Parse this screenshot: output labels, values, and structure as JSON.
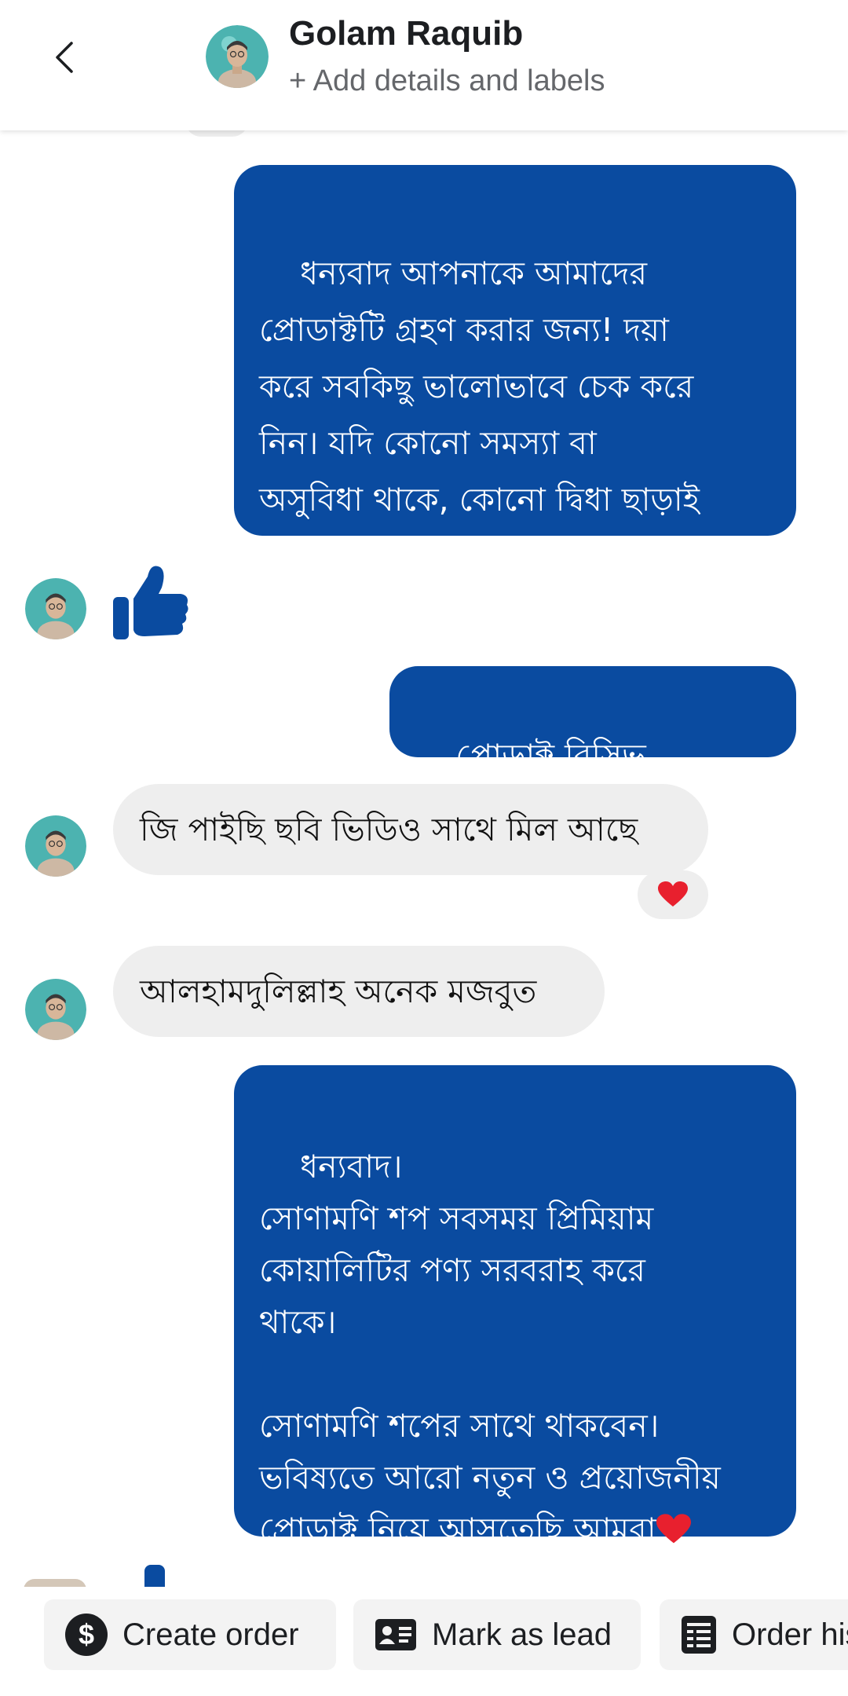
{
  "header": {
    "contact_name": "Golam Raquib",
    "add_details": "+ Add details and labels"
  },
  "messages": [
    {
      "direction": "out",
      "text": "ধন্যবাদ আপনাকে আমাদের\nপ্রোডাক্টটি গ্রহণ করার জন্য! দয়া\nকরে সবকিছু ভালোভাবে চেক করে\nনিন। যদি কোনো সমস্যা বা\nঅসুবিধা থাকে, কোনো দ্বিধা ছাড়াই\nআমাদের জানাবেন।"
    },
    {
      "direction": "in",
      "type": "like-sticker",
      "icon": "thumbs-up-icon"
    },
    {
      "direction": "out",
      "text": "প্রোডাক্ট রিসিভ করেছেন?"
    },
    {
      "direction": "in",
      "text": "জি পাইছি ছবি ভিডিও সাথে মিল আছে",
      "reaction": "heart-icon"
    },
    {
      "direction": "in",
      "text": "আলহামদুলিল্লাহ অনেক মজবুত"
    },
    {
      "direction": "out",
      "text": "ধন্যবাদ।\nসোণামণি শপ সবসময় প্রিমিয়াম\nকোয়ালিটির পণ্য সরবরাহ করে\nথাকে।\n\nসোণামণি শপের সাথে থাকবেন।\nভবিষ্যতে আরো নতুন ও প্রয়োজনীয়\nপ্রোডাক্ট নিয়ে আসতেছি আমরা",
      "trailing_icon": "heart-icon"
    }
  ],
  "actions": [
    {
      "label": "Create order",
      "icon": "dollar-icon"
    },
    {
      "label": "Mark as lead",
      "icon": "contact-card-icon"
    },
    {
      "label": "Order history",
      "icon": "receipt-icon"
    }
  ],
  "colors": {
    "outgoing_bubble": "#0a4ba0",
    "incoming_bubble": "#eeeeee",
    "like_icon": "#0a4ba0",
    "heart": "#e8202e"
  }
}
